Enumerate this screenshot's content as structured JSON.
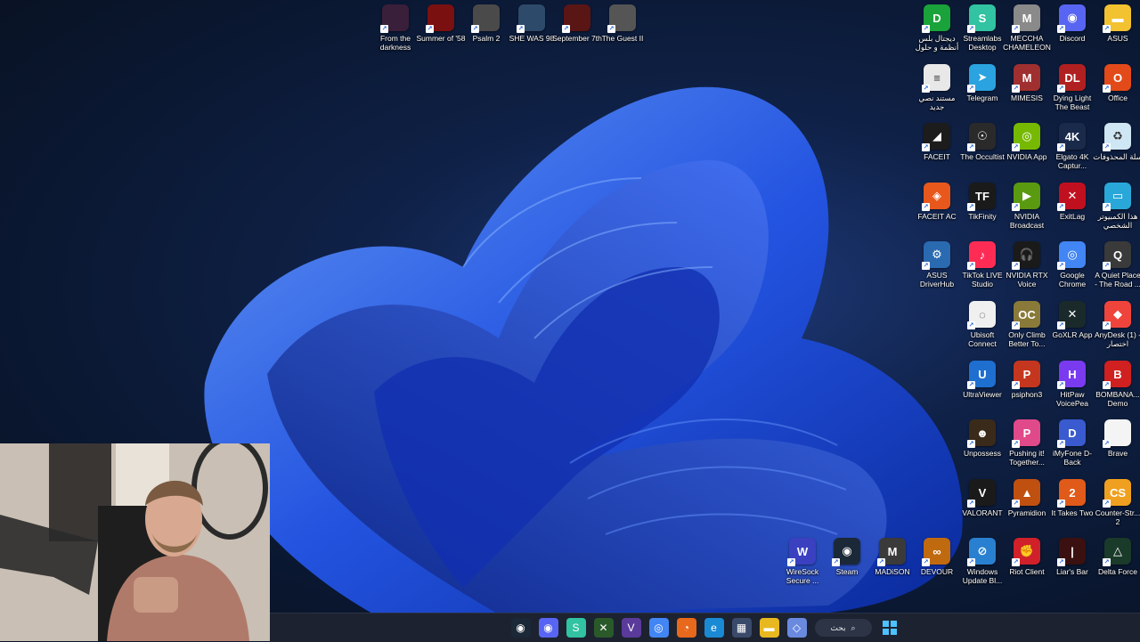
{
  "desktop_top_icons": [
    {
      "label": "From the darkness",
      "icon": "game-thumbnail-icon",
      "color": "#3a1f3a"
    },
    {
      "label": "Summer of '58",
      "icon": "game-thumbnail-icon",
      "color": "#7a1010"
    },
    {
      "label": "Psalm 2",
      "icon": "game-thumbnail-icon",
      "color": "#4a4a4a"
    },
    {
      "label": "SHE WAS 98",
      "icon": "game-thumbnail-icon",
      "color": "#2e4a6a"
    },
    {
      "label": "September 7th",
      "icon": "game-thumbnail-icon",
      "color": "#5a1515"
    },
    {
      "label": "The Guest II",
      "icon": "game-thumbnail-icon",
      "color": "#555555"
    }
  ],
  "desktop_right_icons": [
    [
      {
        "label": "ديجتال بلس أنظمة و حلول",
        "icon": "digital-plus-icon",
        "color": "#1aa33a",
        "glyph": "D"
      },
      {
        "label": "Streamlabs Desktop",
        "icon": "streamlabs-icon",
        "color": "#31c3a2",
        "glyph": "S"
      },
      {
        "label": "MECCHA CHAMELEON",
        "icon": "meccha-chameleon-icon",
        "color": "#8a8a8a",
        "glyph": "M"
      },
      {
        "label": "Discord",
        "icon": "discord-icon",
        "color": "#5865f2",
        "glyph": "◉"
      },
      {
        "label": "ASUS",
        "icon": "folder-icon",
        "color": "#f2c230",
        "glyph": "▬"
      }
    ],
    [
      {
        "label": "مستند نصي جديد",
        "icon": "text-document-icon",
        "color": "#e8e8e8",
        "glyph": "≡"
      },
      {
        "label": "Telegram",
        "icon": "telegram-icon",
        "color": "#2aa3e0",
        "glyph": "➤"
      },
      {
        "label": "MIMESIS",
        "icon": "mimesis-icon",
        "color": "#a03030",
        "glyph": "M"
      },
      {
        "label": "Dying Light The Beast",
        "icon": "dying-light-icon",
        "color": "#b02020",
        "glyph": "DL"
      },
      {
        "label": "Office",
        "icon": "office-icon",
        "color": "#e34a1a",
        "glyph": "O"
      }
    ],
    [
      {
        "label": "FACEIT",
        "icon": "faceit-icon",
        "color": "#1c1c1c",
        "glyph": "◢"
      },
      {
        "label": "The Occultist",
        "icon": "occultist-icon",
        "color": "#2a2a2a",
        "glyph": "☉"
      },
      {
        "label": "NVIDIA App",
        "icon": "nvidia-icon",
        "color": "#76b900",
        "glyph": "◎"
      },
      {
        "label": "Elgato 4K Captur...",
        "icon": "elgato-icon",
        "color": "#1a2a4a",
        "glyph": "4K"
      },
      {
        "label": "سلة المحذوفات",
        "icon": "recycle-bin-icon",
        "color": "#cfe6f4",
        "glyph": "♻"
      }
    ],
    [
      {
        "label": "FACEIT AC",
        "icon": "faceit-ac-icon",
        "color": "#e8581c",
        "glyph": "◈"
      },
      {
        "label": "TikFinity",
        "icon": "tikfinity-icon",
        "color": "#1a1a1a",
        "glyph": "TF"
      },
      {
        "label": "NVIDIA Broadcast",
        "icon": "nvidia-broadcast-icon",
        "color": "#5a9a10",
        "glyph": "▶"
      },
      {
        "label": "ExitLag",
        "icon": "exitlag-icon",
        "color": "#c01020",
        "glyph": "✕"
      },
      {
        "label": "هذا الكمبيوتر الشخصي",
        "icon": "this-pc-icon",
        "color": "#2aa7d9",
        "glyph": "▭"
      }
    ],
    [
      {
        "label": "ASUS DriverHub",
        "icon": "asus-driverhub-icon",
        "color": "#2a6ab0",
        "glyph": "⚙"
      },
      {
        "label": "TikTok LIVE Studio",
        "icon": "tiktok-live-icon",
        "color": "#fe2c55",
        "glyph": "♪"
      },
      {
        "label": "NVIDIA RTX Voice",
        "icon": "nvidia-rtx-voice-icon",
        "color": "#1a1a1a",
        "glyph": "🎧"
      },
      {
        "label": "Google Chrome",
        "icon": "chrome-icon",
        "color": "#4285f4",
        "glyph": "◎"
      },
      {
        "label": "A Quiet Place - The Road ...",
        "icon": "quiet-place-icon",
        "color": "#3a3a3a",
        "glyph": "Q"
      }
    ],
    [
      {
        "label": "Ubisoft Connect",
        "icon": "ubisoft-icon",
        "color": "#f0f0f0",
        "glyph": "◌"
      },
      {
        "label": "Only Climb Better To...",
        "icon": "only-climb-icon",
        "color": "#8a7a3a",
        "glyph": "OC"
      },
      {
        "label": "GoXLR App",
        "icon": "goxlr-icon",
        "color": "#1a2a2a",
        "glyph": "✕"
      },
      {
        "label": "AnyDesk (1) - اختصار",
        "icon": "anydesk-icon",
        "color": "#ef443b",
        "glyph": "◆"
      }
    ],
    [
      {
        "label": "UltraViewer",
        "icon": "ultraviewer-icon",
        "color": "#1e6fd0",
        "glyph": "U"
      },
      {
        "label": "psiphon3",
        "icon": "psiphon-icon",
        "color": "#c5361f",
        "glyph": "P"
      },
      {
        "label": "HitPaw VoicePea",
        "icon": "hitpaw-icon",
        "color": "#7a3af0",
        "glyph": "H"
      },
      {
        "label": "BOMBANA... Demo",
        "icon": "bombana-icon",
        "color": "#d02020",
        "glyph": "B"
      }
    ],
    [
      {
        "label": "Unpossess",
        "icon": "unpossess-icon",
        "color": "#3a2a1a",
        "glyph": "☻"
      },
      {
        "label": "Pushing it! Together...",
        "icon": "pushing-it-icon",
        "color": "#e04a8a",
        "glyph": "P"
      },
      {
        "label": "iMyFone D-Back",
        "icon": "imyfone-icon",
        "color": "#3a5ad0",
        "glyph": "D"
      },
      {
        "label": "Brave",
        "icon": "blank-document-icon",
        "color": "#f4f4f4",
        "glyph": ""
      }
    ],
    [
      {
        "label": "VALORANT",
        "icon": "valorant-icon",
        "color": "#1a1a1a",
        "glyph": "V"
      },
      {
        "label": "Pyramidion",
        "icon": "pyramidion-icon",
        "color": "#c05010",
        "glyph": "▲"
      },
      {
        "label": "It Takes Two",
        "icon": "it-takes-two-icon",
        "color": "#e05a1a",
        "glyph": "2"
      },
      {
        "label": "Counter-Str... 2",
        "icon": "counter-strike-icon",
        "color": "#f0a020",
        "glyph": "CS"
      }
    ],
    [
      {
        "label": "WireSock Secure ...",
        "icon": "wiresock-icon",
        "color": "#3a40c0",
        "glyph": "W"
      },
      {
        "label": "Steam",
        "icon": "steam-icon",
        "color": "#1b2838",
        "glyph": "◉"
      },
      {
        "label": "MADiSON",
        "icon": "madison-icon",
        "color": "#3a3a3a",
        "glyph": "M"
      },
      {
        "label": "DEVOUR",
        "icon": "devour-icon",
        "color": "#c06a10",
        "glyph": "∞"
      },
      {
        "label": "Windows Update Bl...",
        "icon": "windows-update-blocker-icon",
        "color": "#2a80d0",
        "glyph": "⊘"
      },
      {
        "label": "Riot Client",
        "icon": "riot-client-icon",
        "color": "#d0202a",
        "glyph": "✊"
      },
      {
        "label": "Liar's Bar",
        "icon": "liars-bar-icon",
        "color": "#3a1010",
        "glyph": "|"
      },
      {
        "label": "Delta Force",
        "icon": "delta-force-icon",
        "color": "#1a3a2a",
        "glyph": "△"
      }
    ]
  ],
  "taskbar": {
    "items": [
      {
        "name": "steam-taskbar-icon",
        "glyph": "◉",
        "color": "#1b2838"
      },
      {
        "name": "discord-taskbar-icon",
        "glyph": "◉",
        "color": "#5865f2"
      },
      {
        "name": "streamlabs-taskbar-icon",
        "glyph": "S",
        "color": "#31c3a2"
      },
      {
        "name": "xbox-taskbar-icon",
        "glyph": "✕",
        "color": "#2a5a2a"
      },
      {
        "name": "visual-studio-taskbar-icon",
        "glyph": "V",
        "color": "#5a3a9a"
      },
      {
        "name": "chrome-taskbar-icon",
        "glyph": "◎",
        "color": "#4285f4"
      },
      {
        "name": "firefox-taskbar-icon",
        "glyph": "◔",
        "color": "#e8681c"
      },
      {
        "name": "edge-taskbar-icon",
        "glyph": "e",
        "color": "#1a8ad4"
      },
      {
        "name": "store-taskbar-icon",
        "glyph": "▦",
        "color": "#3a4a6a"
      },
      {
        "name": "file-explorer-taskbar-icon",
        "glyph": "▬",
        "color": "#e8b820"
      },
      {
        "name": "copilot-taskbar-icon",
        "glyph": "◇",
        "color": "#6a8ae0"
      }
    ],
    "search_label": "بحث",
    "start_icon": "windows-start-icon"
  }
}
